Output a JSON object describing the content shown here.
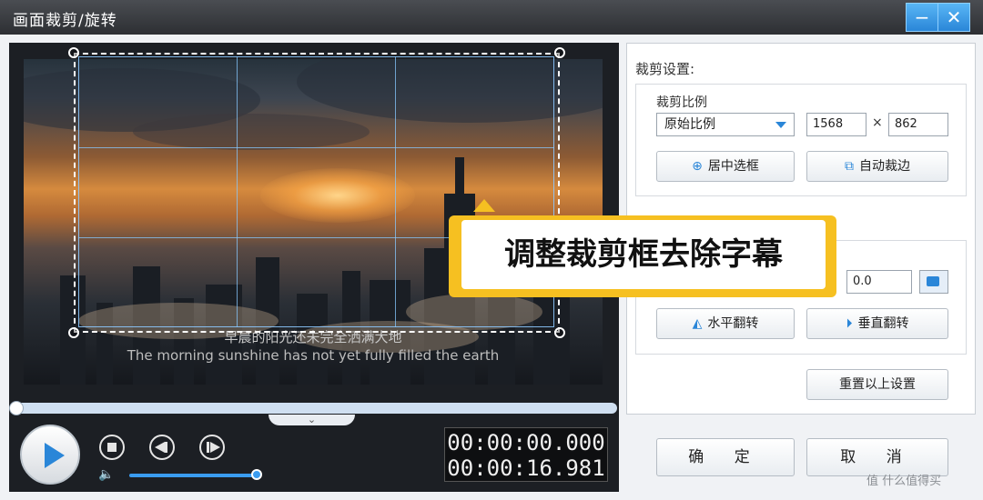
{
  "window": {
    "title": "画面裁剪/旋转",
    "min_label": "−",
    "close_label": "✕"
  },
  "video": {
    "subtitle_cn": "早晨的阳光还未完全洒满大地",
    "subtitle_en": "The morning sunshine has not yet fully filled the earth"
  },
  "player": {
    "current_time": "00:00:00.000",
    "total_time": "00:00:16.981",
    "collapse_label": "⌄",
    "volume_icon": "🔈"
  },
  "crop": {
    "section_title": "裁剪设置:",
    "ratio_label": "裁剪比例",
    "ratio_value": "原始比例",
    "width": "1568",
    "times": "×",
    "height": "862",
    "center_button": "居中选框",
    "auto_button": "自动裁边"
  },
  "rotate": {
    "angle": "0.0",
    "hflip_button": "水平翻转",
    "vflip_button": "垂直翻转",
    "reset_button": "重置以上设置"
  },
  "footer": {
    "ok_button": "确 定",
    "cancel_button": "取 消"
  },
  "callout": {
    "text": "调整裁剪框去除字幕"
  },
  "watermark": {
    "text": "值 什么值得买"
  },
  "colors": {
    "accent": "#2a86d8",
    "callout": "#f6c021"
  }
}
